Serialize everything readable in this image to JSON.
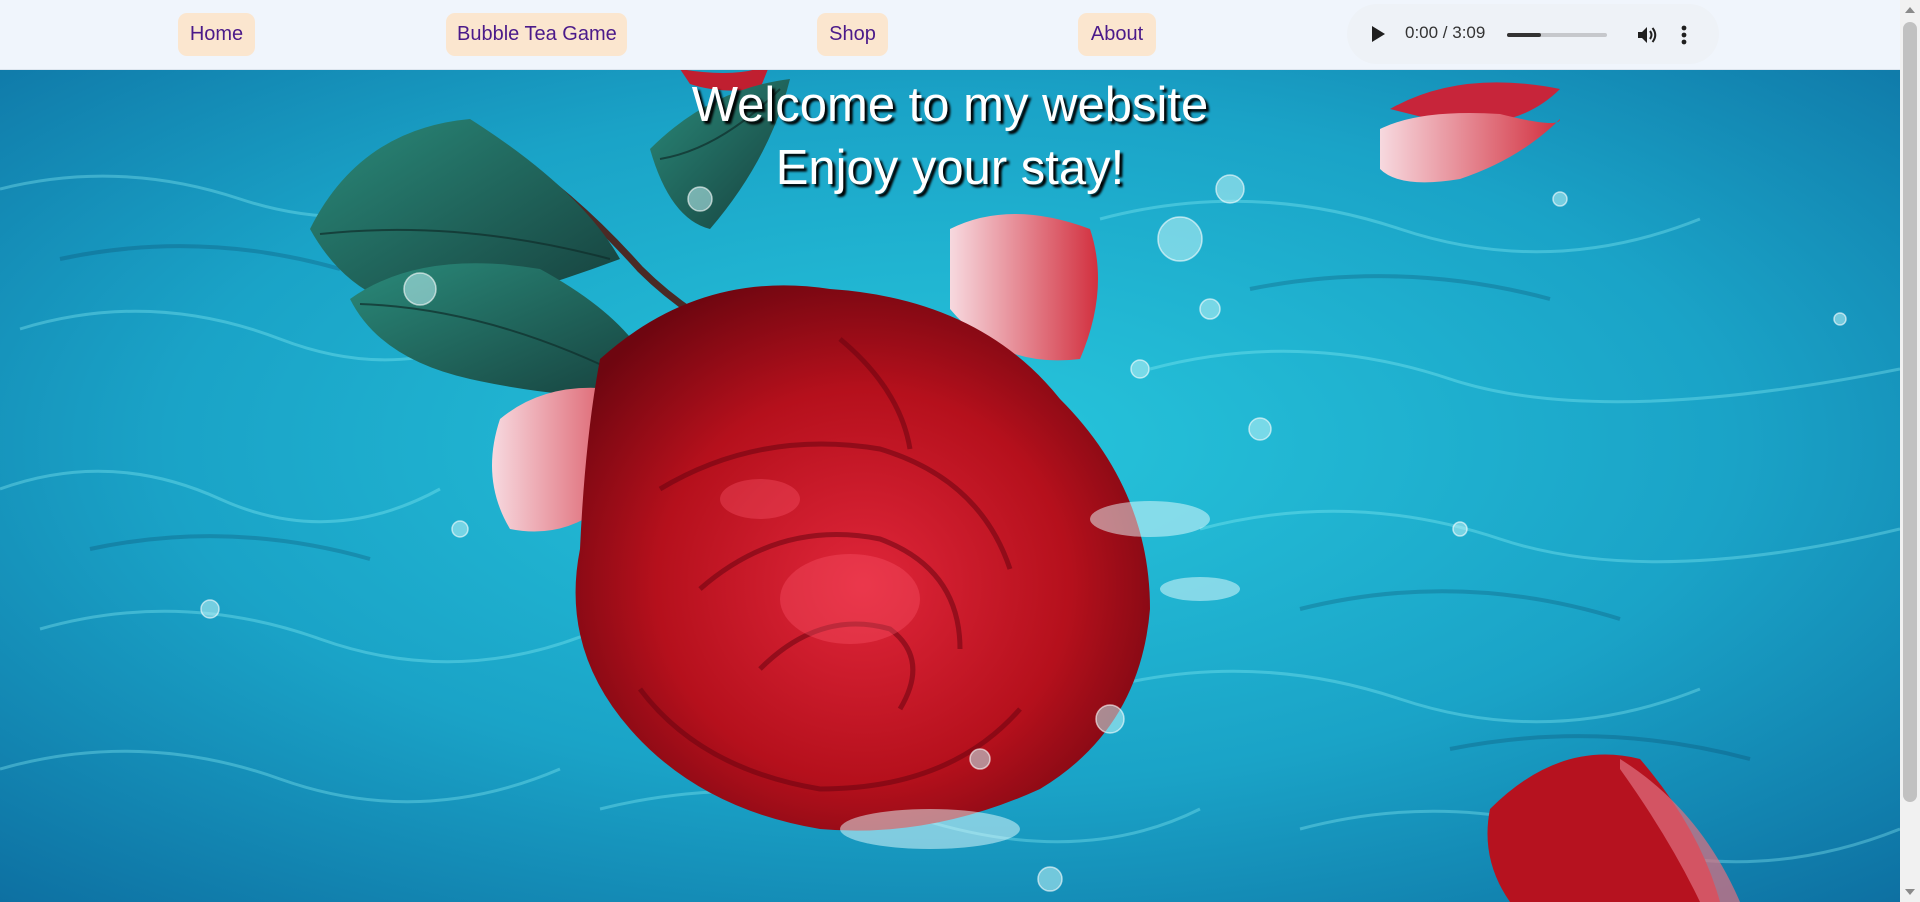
{
  "nav": {
    "home_label": "Home",
    "bubble_label": "Bubble Tea Game",
    "shop_label": "Shop",
    "about_label": "About"
  },
  "audio": {
    "time_display": "0:00 / 3:09",
    "progress_fraction": 0.34
  },
  "hero": {
    "title_line1": "Welcome to my website",
    "title_line2": "Enjoy your stay!",
    "image_subject": "red rose floating in turquoise water"
  },
  "colors": {
    "nav_bg": "#f0f5fc",
    "nav_button_bg": "#fbe6cf",
    "nav_button_text": "#4b1a8a",
    "water": "#1aa6c4",
    "rose": "#b5101c"
  }
}
